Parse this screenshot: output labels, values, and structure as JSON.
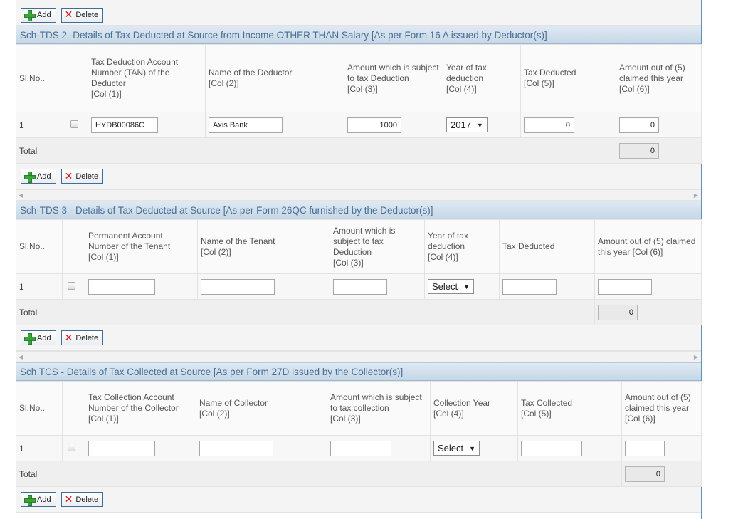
{
  "buttons": {
    "add": "Add",
    "delete": "Delete"
  },
  "tds2": {
    "title": "Sch-TDS 2 -Details of Tax Deducted at Source from Income OTHER THAN Salary [As per Form 16 A issued by Deductor(s)]",
    "headers": {
      "slno": "Sl.No..",
      "col1": "Tax Deduction Account Number (TAN) of the Deductor\n[Col (1)]",
      "col2": "Name of the Deductor\n[Col (2)]",
      "col3": "Amount which is subject to tax Deduction\n[Col (3)]",
      "col4": "Year of tax deduction\n[Col (4)]",
      "col5": "Tax Deducted\n[Col (5)]",
      "col6": "Amount out of (5) claimed this year\n[Col (6)]"
    },
    "row": {
      "sl": "1",
      "tan": "HYDB00086C",
      "name": "Axis Bank",
      "amount": "1000",
      "year": "2017",
      "tax": "0",
      "claimed": "0"
    },
    "total_label": "Total",
    "total_value": "0"
  },
  "tds3": {
    "title": "Sch-TDS 3 - Details of Tax Deducted at Source [As per Form 26QC furnished by the Deductor(s)]",
    "headers": {
      "slno": "Sl.No..",
      "col1": "Permanent Account Number of the Tenant\n[Col (1)]",
      "col2": "Name of the Tenant\n[Col (2)]",
      "col3": "Amount which is subject to tax Deduction\n[Col (3)]",
      "col4": "Year of tax deduction\n[Col (4)]",
      "col5": "Tax Deducted",
      "col6": "Amount out of (5) claimed this year [Col (6)]"
    },
    "row": {
      "sl": "1",
      "year": "Select"
    },
    "total_label": "Total",
    "total_value": "0"
  },
  "tcs": {
    "title": "Sch TCS - Details of Tax Collected at Source [As per Form 27D issued by the Collector(s)]",
    "headers": {
      "slno": "Sl.No..",
      "col1": "Tax Collection Account Number of the Collector\n[Col (1)]",
      "col2": "Name of Collector\n[Col (2)]",
      "col3": "Amount which is subject to tax collection\n[Col (3)]",
      "col4": "Collection Year\n[Col (4)]",
      "col5": "Tax Collected\n[Col (5)]",
      "col6": "Amount out of (5) claimed this year\n[Col (6)]"
    },
    "row": {
      "sl": "1",
      "year": "Select"
    },
    "total_label": "Total",
    "total_value": "0"
  },
  "icons": {
    "add": "plus-icon",
    "delete": "x-icon",
    "scroll_left": "arrow-left-icon",
    "scroll_right": "arrow-right-icon"
  },
  "colors": {
    "section_title": "#4a6f93",
    "button_border": "#3f6f98",
    "frame_border": "#5b93c2"
  }
}
